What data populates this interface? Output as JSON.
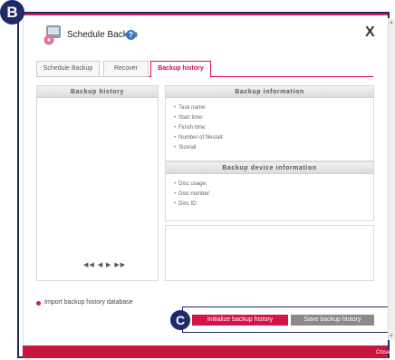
{
  "callouts": {
    "b": "B",
    "c": "C"
  },
  "dialog": {
    "title": "Schedule Backup",
    "help_icon": "question-icon",
    "help_glyph": "?",
    "close_glyph": "X"
  },
  "tabs": [
    {
      "label": "Schedule Backup",
      "active": false
    },
    {
      "label": "Recover",
      "active": false
    },
    {
      "label": "Backup history",
      "active": true
    }
  ],
  "history_panel": {
    "title": "Backup history",
    "nav_glyphs": "◀◀ ◀ ▶ ▶▶"
  },
  "info_panel": {
    "title": "Backup information",
    "fields": [
      "Task name:",
      "Start time:",
      "Finish time:",
      "Number of files/all:",
      "Size/all"
    ]
  },
  "device_panel": {
    "title": "Backup device information",
    "fields": [
      "Disc usage:",
      "Disc number:",
      "Disc ID:"
    ]
  },
  "import": {
    "label": "Import backup history database"
  },
  "buttons": {
    "initialize": "Initialize backup history",
    "save": "Save backup history"
  },
  "footer": {
    "close_tab": "Close"
  },
  "colors": {
    "accent": "#d2144a",
    "callout": "#1f2a6b",
    "band": "#c8153e",
    "secondary_button": "#8a8a8a"
  }
}
